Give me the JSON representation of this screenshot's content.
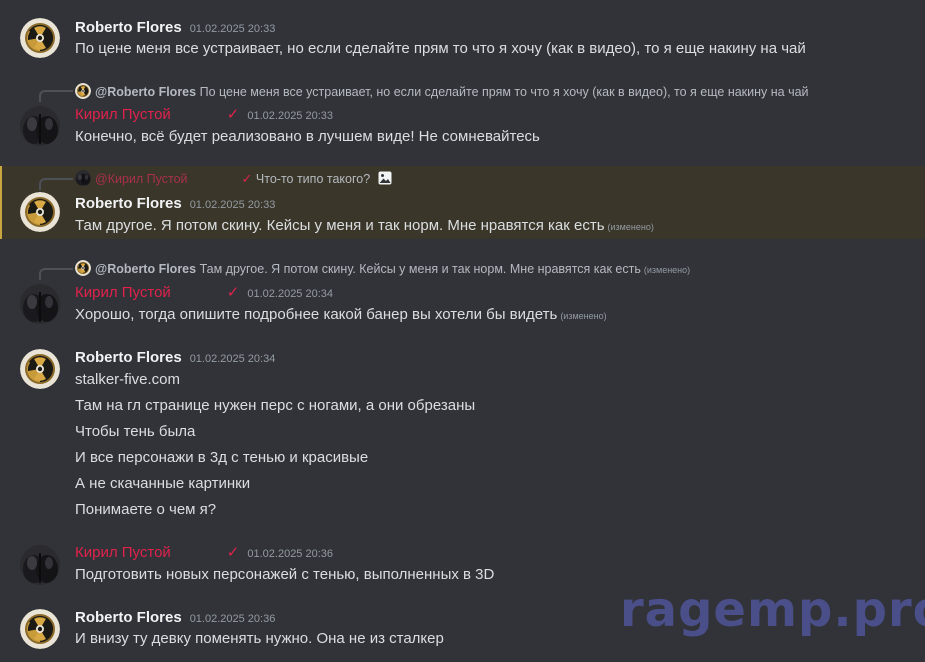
{
  "users": {
    "roberto": {
      "name": "Roberto Flores"
    },
    "kiril": {
      "name": "Кирил Пустой",
      "check": "✓"
    }
  },
  "messages": [
    {
      "author": "Roberto Flores",
      "time": "01.02.2025 20:33",
      "lines": [
        "По цене меня все устраивает, но если сделайте прям то что я хочу (как в видео), то я еще накину на чай"
      ]
    },
    {
      "reply": {
        "name": "@Roberto Flores",
        "text": "По цене меня все устраивает, но если сделайте прям то что я хочу (как в видео), то я еще накину на чай"
      },
      "author": "Кирил Пустой",
      "check": "✓",
      "time": "01.02.2025 20:33",
      "lines": [
        "Конечно, всё будет реализовано в лучшем виде! Не сомневайтесь"
      ]
    },
    {
      "reply": {
        "name": "@Кирил Пустой",
        "check": "✓",
        "text": "Что-то типо такого?"
      },
      "author": "Roberto Flores",
      "time": "01.02.2025 20:33",
      "lines": [
        "Там другое. Я потом скину. Кейсы у меня и так норм. Мне нравятся как есть"
      ],
      "edited": "(изменено)"
    },
    {
      "reply": {
        "name": "@Roberto Flores",
        "text": "Там другое. Я потом скину. Кейсы у меня и так норм. Мне нравятся как есть",
        "edited": "(изменено)"
      },
      "author": "Кирил Пустой",
      "check": "✓",
      "time": "01.02.2025 20:34",
      "lines": [
        "Хорошо, тогда опишите подробнее какой банер вы хотели бы видеть"
      ],
      "edited": "(изменено)"
    },
    {
      "author": "Roberto Flores",
      "time": "01.02.2025 20:34",
      "lines": [
        "stalker-five.com",
        "Там на гл странице нужен перс с ногами, а они обрезаны",
        "Чтобы тень была",
        "И все персонажи в 3д с тенью и красивые",
        "А не скачанные картинки",
        "Понимаете о чем я?"
      ]
    },
    {
      "author": "Кирил Пустой",
      "check": "✓",
      "time": "01.02.2025 20:36",
      "lines": [
        "Подготовить новых персонажей с тенью, выполненных в 3D"
      ]
    },
    {
      "author": "Roberto Flores",
      "time": "01.02.2025 20:36",
      "lines": [
        "И внизу ту девку поменять нужно. Она не из сталкер"
      ]
    }
  ],
  "watermark": "ragemp.pro",
  "colors": {
    "background": "#313338",
    "mention_bg": "#3a3629",
    "mention_bar": "#c9a640",
    "role_pink": "#e0224b"
  },
  "icons": {
    "roberto_avatar": "radiation-icon",
    "kiril_avatar": "photo-avatar",
    "attachment": "image-icon"
  }
}
